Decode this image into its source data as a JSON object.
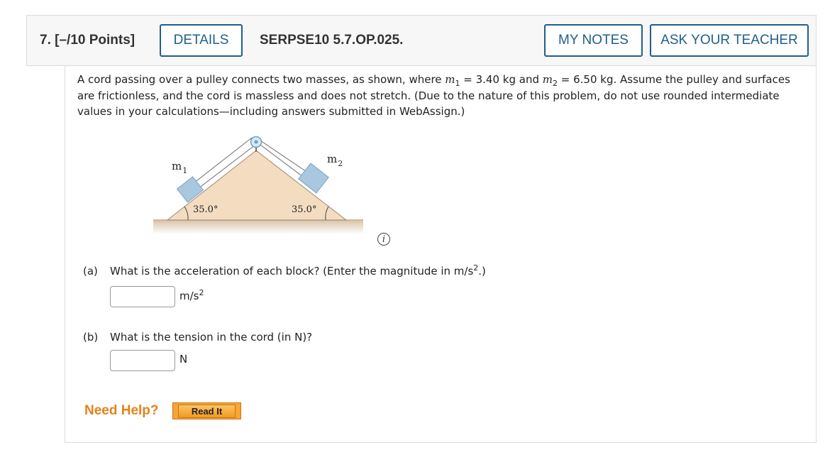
{
  "question": {
    "number": "7.",
    "points": "[–/10 Points]",
    "details_label": "DETAILS",
    "code": "SERPSE10 5.7.OP.025.",
    "my_notes_label": "MY NOTES",
    "ask_teacher_label": "ASK YOUR TEACHER"
  },
  "problem": {
    "text_1": "A cord passing over a pulley connects two masses, as shown, where ",
    "m1_var": "m",
    "m1_sub": "1",
    "text_2": " = 3.40 kg and ",
    "m2_var": "m",
    "m2_sub": "2",
    "text_3": " = 6.50 kg. Assume the pulley and surfaces are frictionless, and the cord is massless and does not stretch. (Due to the nature of this problem, do not use rounded intermediate values in your calculations—including answers submitted in WebAssign.)"
  },
  "figure": {
    "m1_label": "m",
    "m1_sub": "1",
    "m2_label": "m",
    "m2_sub": "2",
    "angle_left": "35.0°",
    "angle_right": "35.0°",
    "info_icon_glyph": "i"
  },
  "parts": [
    {
      "label": "(a)",
      "question_1": "What is the acceleration of each block? (Enter the magnitude in m/s",
      "question_sup": "2",
      "question_2": ".)",
      "answer_value": "",
      "unit": "m/s",
      "unit_sup": "2"
    },
    {
      "label": "(b)",
      "question": "What is the tension in the cord (in N)?",
      "answer_value": "",
      "unit": "N"
    }
  ],
  "help": {
    "need_help_label": "Need Help?",
    "read_it_label": "Read It"
  },
  "colors": {
    "accent": "#1f5f8b",
    "need_help": "#e8801a",
    "read_it_button": "#f6a631",
    "block": "#a9c8df",
    "incline": "#f3dcc0"
  }
}
